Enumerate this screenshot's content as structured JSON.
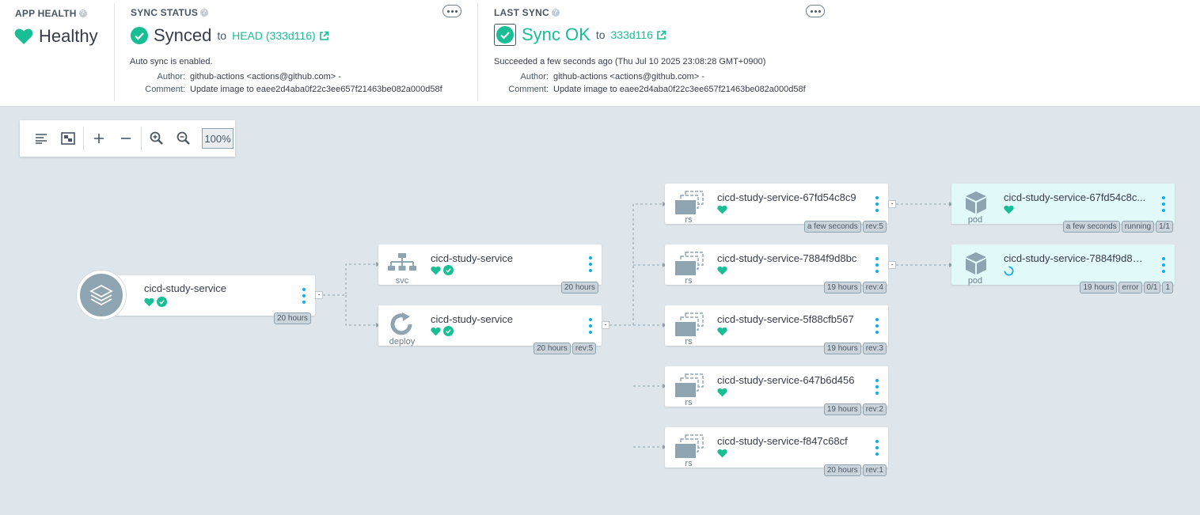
{
  "app_health": {
    "title": "APP HEALTH",
    "status": "Healthy"
  },
  "sync_status": {
    "title": "SYNC STATUS",
    "status": "Synced",
    "to": "to",
    "revision": "HEAD (333d116)",
    "auto_sync": "Auto sync is enabled.",
    "author_label": "Author:",
    "author": "github-actions <actions@github.com> -",
    "comment_label": "Comment:",
    "comment": "Update image to eaee2d4aba0f22c3ee657f21463be082a000d58f"
  },
  "last_sync": {
    "title": "LAST SYNC",
    "status": "Sync OK",
    "to": "to",
    "revision": "333d116",
    "succeeded": "Succeeded a few seconds ago (Thu Jul 10 2025 23:08:28 GMT+0900)",
    "author_label": "Author:",
    "author": "github-actions <actions@github.com> -",
    "comment_label": "Comment:",
    "comment": "Update image to eaee2d4aba0f22c3ee657f21463be082a000d58f"
  },
  "toolbar": {
    "zoom": "100%"
  },
  "nodes": {
    "app": {
      "name": "cicd-study-service",
      "tags": [
        "20 hours"
      ]
    },
    "svc": {
      "name": "cicd-study-service",
      "kind": "svc",
      "tags": [
        "20 hours"
      ]
    },
    "deploy": {
      "name": "cicd-study-service",
      "kind": "deploy",
      "tags": [
        "20 hours",
        "rev:5"
      ]
    },
    "rs": [
      {
        "name": "cicd-study-service-67fd54c8c9",
        "kind": "rs",
        "tags": [
          "a few seconds",
          "rev:5"
        ]
      },
      {
        "name": "cicd-study-service-7884f9d8bc",
        "kind": "rs",
        "tags": [
          "19 hours",
          "rev:4"
        ]
      },
      {
        "name": "cicd-study-service-5f88cfb567",
        "kind": "rs",
        "tags": [
          "19 hours",
          "rev:3"
        ]
      },
      {
        "name": "cicd-study-service-647b6d456",
        "kind": "rs",
        "tags": [
          "19 hours",
          "rev:2"
        ]
      },
      {
        "name": "cicd-study-service-f847c68cf",
        "kind": "rs",
        "tags": [
          "20 hours",
          "rev:1"
        ]
      }
    ],
    "pods": [
      {
        "name": "cicd-study-service-67fd54c8c...",
        "kind": "pod",
        "tags": [
          "a few seconds",
          "running",
          "1/1"
        ],
        "status": "healthy"
      },
      {
        "name": "cicd-study-service-7884f9d8b...",
        "kind": "pod",
        "tags": [
          "19 hours",
          "error",
          "0/1",
          "1"
        ],
        "status": "progressing"
      }
    ]
  },
  "colors": {
    "healthy": "#18be94",
    "accent": "#0dadea",
    "progressing": "#0dadea"
  },
  "icons": [
    "heart-icon",
    "check-circle-icon",
    "external-link-icon",
    "more-icon",
    "align-icon",
    "fit-icon",
    "plus-icon",
    "minus-icon",
    "zoom-in-icon",
    "zoom-out-icon",
    "layers-icon",
    "network-icon",
    "sync-icon",
    "stack-icon",
    "cube-icon",
    "spinner-icon"
  ]
}
